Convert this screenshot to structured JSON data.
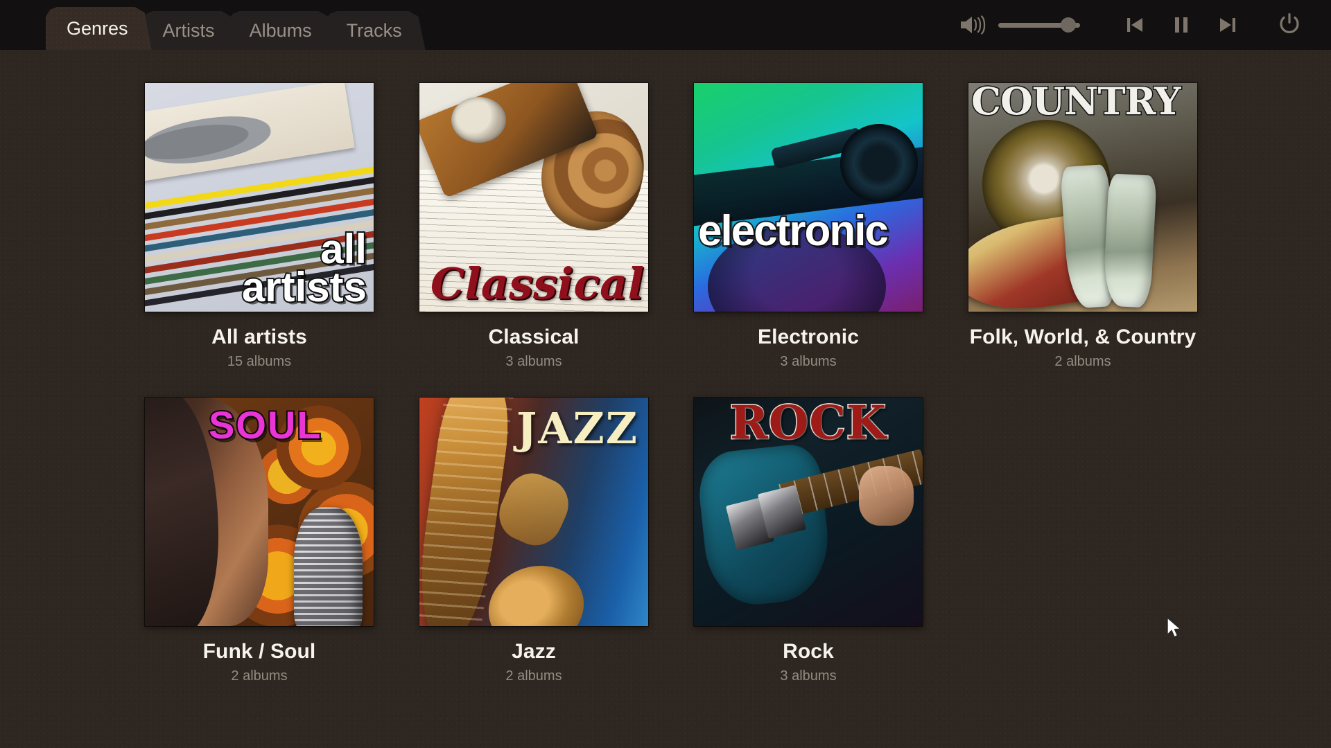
{
  "header": {
    "tabs": [
      {
        "label": "Genres",
        "active": true
      },
      {
        "label": "Artists",
        "active": false
      },
      {
        "label": "Albums",
        "active": false
      },
      {
        "label": "Tracks",
        "active": false
      }
    ],
    "controls": {
      "speaker_icon": "speaker-volume-icon",
      "volume_value": 86,
      "previous_icon": "previous-track-icon",
      "pause_icon": "pause-icon",
      "next_icon": "next-track-icon",
      "power_icon": "power-icon"
    }
  },
  "grid": {
    "tiles": [
      {
        "title": "All artists",
        "subtitle": "15 albums",
        "art_text": "all\nartists",
        "art_name": "all-artists-cover"
      },
      {
        "title": "Classical",
        "subtitle": "3 albums",
        "art_text": "Classical",
        "art_name": "classical-cover"
      },
      {
        "title": "Electronic",
        "subtitle": "3 albums",
        "art_text": "electronic",
        "art_name": "electronic-cover"
      },
      {
        "title": "Folk, World, & Country",
        "subtitle": "2 albums",
        "art_text": "COUNTRY",
        "art_name": "country-cover"
      },
      {
        "title": "Funk / Soul",
        "subtitle": "2 albums",
        "art_text": "SOUL",
        "art_name": "soul-cover"
      },
      {
        "title": "Jazz",
        "subtitle": "2 albums",
        "art_text": "JAZZ",
        "art_name": "jazz-cover"
      },
      {
        "title": "Rock",
        "subtitle": "3 albums",
        "art_text": "ROCK",
        "art_name": "rock-cover"
      }
    ]
  },
  "colors": {
    "background": "#2e2620",
    "header": "#121010",
    "active_tab_text": "#f4f1ec",
    "inactive_tab_text": "#9a9087",
    "title_text": "#f6f3ee",
    "subtitle_text": "#958b81",
    "control_icon": "#7e766b"
  }
}
